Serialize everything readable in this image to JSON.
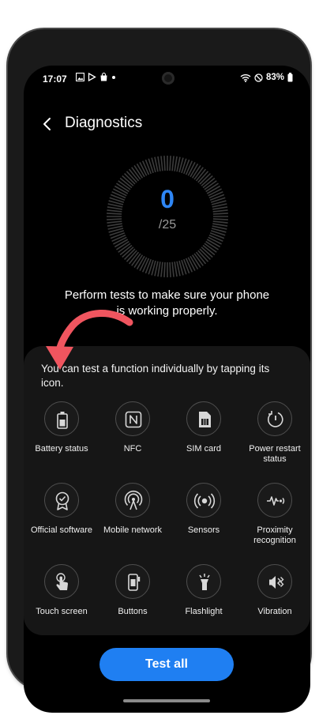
{
  "status_bar": {
    "time": "17:07",
    "notification_icons": [
      "image-icon",
      "play-store-icon",
      "shopping-bag-icon",
      "dot-icon"
    ],
    "system_icons": [
      "wifi-icon",
      "do-not-disturb-icon",
      "battery-icon"
    ],
    "battery_percent": "83%"
  },
  "header": {
    "title": "Diagnostics"
  },
  "progress": {
    "completed": "0",
    "total": "/25"
  },
  "description": "Perform tests to make sure your phone is working properly.",
  "panel": {
    "hint": "You can test a function individually by tapping its icon."
  },
  "tests": [
    {
      "label": "Battery status",
      "icon": "battery-icon"
    },
    {
      "label": "NFC",
      "icon": "nfc-icon"
    },
    {
      "label": "SIM card",
      "icon": "sim-card-icon"
    },
    {
      "label": "Power restart status",
      "icon": "power-restart-icon"
    },
    {
      "label": "Official software",
      "icon": "badge-icon"
    },
    {
      "label": "Mobile network",
      "icon": "antenna-icon"
    },
    {
      "label": "Sensors",
      "icon": "sensor-icon"
    },
    {
      "label": "Proximity recognition",
      "icon": "proximity-icon"
    },
    {
      "label": "Touch screen",
      "icon": "touch-icon"
    },
    {
      "label": "Buttons",
      "icon": "phone-buttons-icon"
    },
    {
      "label": "Flashlight",
      "icon": "flashlight-icon"
    },
    {
      "label": "Vibration",
      "icon": "vibration-icon"
    }
  ],
  "actions": {
    "test_all": "Test all"
  },
  "colors": {
    "accent": "#1f7ff2",
    "count": "#2e86f5",
    "annotation_arrow": "#f0555f"
  }
}
